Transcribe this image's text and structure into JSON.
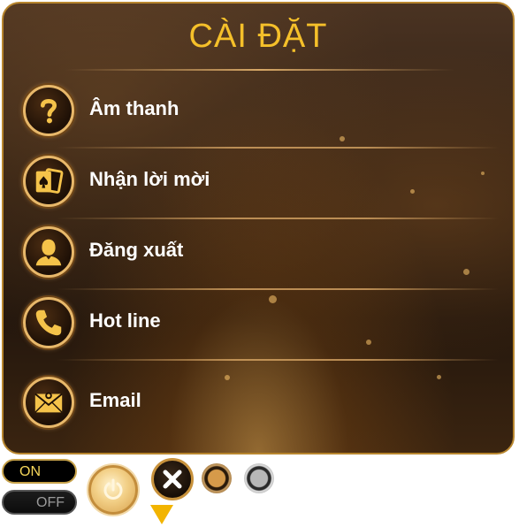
{
  "dialog": {
    "title": "CÀI ĐẶT",
    "items": [
      {
        "label": "Âm thanh",
        "icon": "question-icon"
      },
      {
        "label": "Nhận lời mời",
        "icon": "cards-icon"
      },
      {
        "label": "Đăng xuất",
        "icon": "user-icon"
      },
      {
        "label": "Hot line",
        "icon": "phone-icon"
      },
      {
        "label": "Email",
        "icon": "envelope-icon"
      }
    ]
  },
  "controls": {
    "toggle_on_label": "ON",
    "toggle_off_label": "OFF"
  },
  "colors": {
    "accent_gold": "#f5c02a",
    "border_gold": "#e8b86a",
    "panel_dark": "#2e1e12",
    "arrow_yellow": "#f2b400"
  }
}
